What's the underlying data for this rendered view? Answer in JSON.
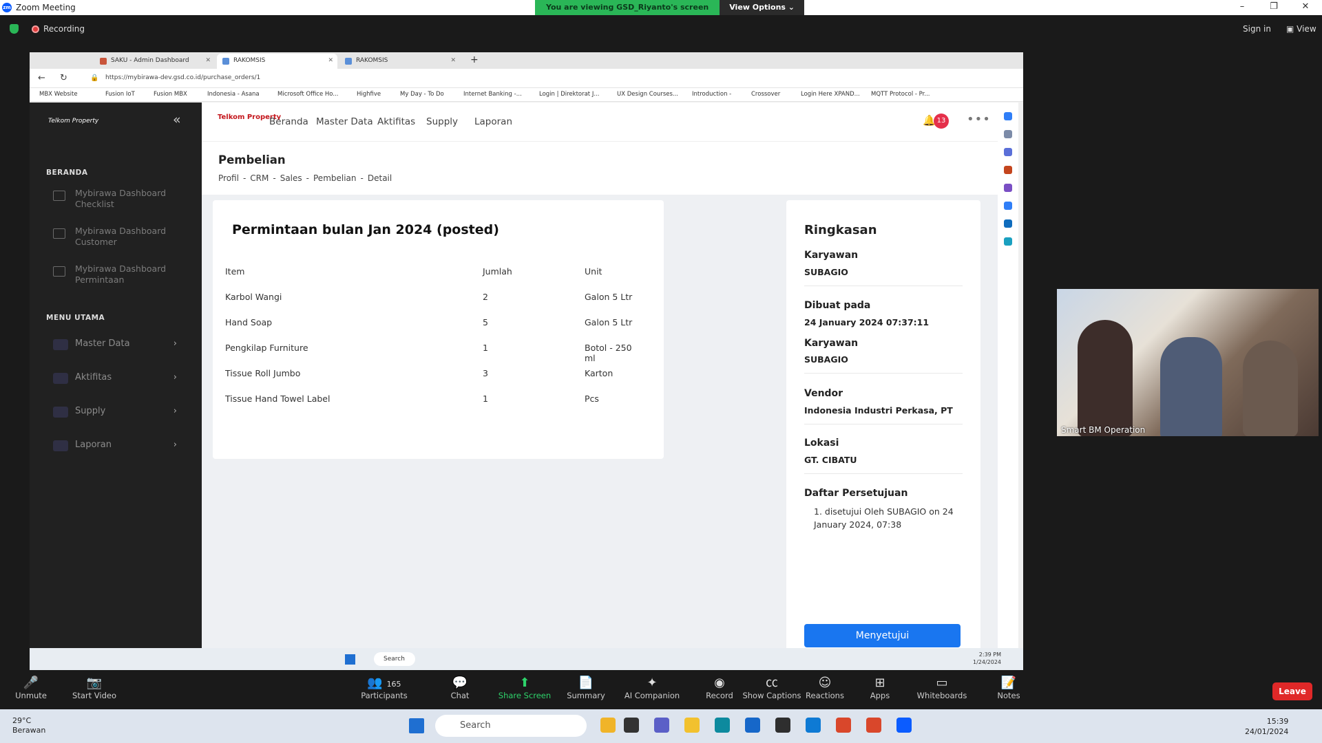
{
  "zoom": {
    "window_title": "Zoom Meeting",
    "banner_text": "You are viewing GSD_Riyanto's screen",
    "view_options": "View Options",
    "recording": "Recording",
    "sign_in": "Sign in",
    "view": "View",
    "participant_name": "Smart BM Operation",
    "participants_count": "165",
    "toolbar": [
      "Unmute",
      "Start Video",
      "Participants",
      "Chat",
      "Share Screen",
      "Summary",
      "AI Companion",
      "Record",
      "Show Captions",
      "Reactions",
      "Apps",
      "Whiteboards",
      "Notes"
    ],
    "leave": "Leave"
  },
  "browser": {
    "tabs": [
      "SAKU - Admin Dashboard",
      "RAKOMSIS",
      "RAKOMSIS"
    ],
    "url": "https://mybirawa-dev.gsd.co.id/purchase_orders/1",
    "bookmarks": [
      "MBX Website",
      "Fusion IoT",
      "Fusion MBX",
      "Indonesia - Asana",
      "Microsoft Office Ho...",
      "Highfive",
      "My Day - To Do",
      "Internet Banking -...",
      "Login | Direktorat J...",
      "UX Design Courses...",
      "Introduction -",
      "Crossover",
      "Login Here XPAND...",
      "MQTT Protocol - Pr..."
    ]
  },
  "sidebar": {
    "logo": "Telkom Property",
    "section1": "BERANDA",
    "dashboards": [
      "Mybirawa Dashboard Checklist",
      "Mybirawa Dashboard Customer",
      "Mybirawa Dashboard Permintaan"
    ],
    "section2": "MENU UTAMA",
    "menu": [
      "Master Data",
      "Aktifitas",
      "Supply",
      "Laporan"
    ]
  },
  "topnav": {
    "brand": "Telkom Property",
    "items": [
      "Beranda",
      "Master Data",
      "Aktifitas",
      "Supply",
      "Laporan"
    ],
    "notif_count": "13"
  },
  "page": {
    "title": "Pembelian",
    "breadcrumb": [
      "Profil",
      "-",
      "CRM",
      "-",
      "Sales",
      "-",
      "Pembelian",
      "-",
      "Detail"
    ]
  },
  "order": {
    "heading": "Permintaan bulan Jan 2024 (posted)",
    "columns": [
      "Item",
      "Jumlah",
      "Unit"
    ],
    "rows": [
      [
        "Karbol Wangi",
        "2",
        "Galon 5 Ltr"
      ],
      [
        "Hand Soap",
        "5",
        "Galon 5 Ltr"
      ],
      [
        "Pengkilap Furniture",
        "1",
        "Botol - 250 ml"
      ],
      [
        "Tissue Roll Jumbo",
        "3",
        "Karton"
      ],
      [
        "Tissue Hand Towel Label",
        "1",
        "Pcs"
      ]
    ]
  },
  "summary": {
    "heading": "Ringkasan",
    "karyawan_label": "Karyawan",
    "karyawan": "SUBAGIO",
    "dibuat_label": "Dibuat pada",
    "dibuat": "24 January 2024 07:37:11",
    "karyawan2_label": "Karyawan",
    "karyawan2": "SUBAGIO",
    "vendor_label": "Vendor",
    "vendor": "Indonesia Industri Perkasa, PT",
    "lokasi_label": "Lokasi",
    "lokasi": "GT. CIBATU",
    "persetujuan_label": "Daftar Persetujuan",
    "persetujuan": "1. disetujui Oleh SUBAGIO on 24 January 2024, 07:38",
    "button": "Menyetujui"
  },
  "inner_taskbar": {
    "search": "Search",
    "time": "2:39 PM",
    "date": "1/24/2024"
  },
  "windows": {
    "temp": "29°C",
    "weather": "Berawan",
    "search": "Search",
    "time": "15:39",
    "date": "24/01/2024"
  }
}
